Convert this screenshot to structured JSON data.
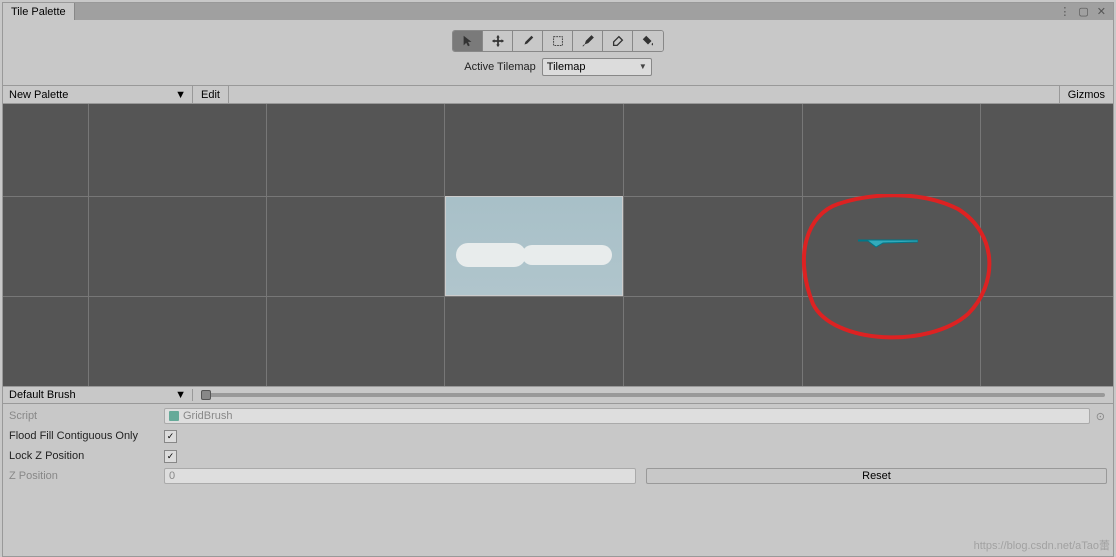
{
  "tab": {
    "title": "Tile Palette"
  },
  "tilemap": {
    "label": "Active Tilemap",
    "selected": "Tilemap"
  },
  "secondary": {
    "palette": "New Palette",
    "edit": "Edit",
    "gizmos": "Gizmos"
  },
  "brush": {
    "selected": "Default Brush"
  },
  "props": {
    "script_label": "Script",
    "script_value": "GridBrush",
    "floodfill_label": "Flood Fill Contiguous Only",
    "floodfill_checked": "✓",
    "lockz_label": "Lock Z Position",
    "lockz_checked": "✓",
    "zpos_label": "Z Position",
    "zpos_value": "0",
    "reset_label": "Reset"
  },
  "watermark": "https://blog.csdn.net/aTao蕾"
}
